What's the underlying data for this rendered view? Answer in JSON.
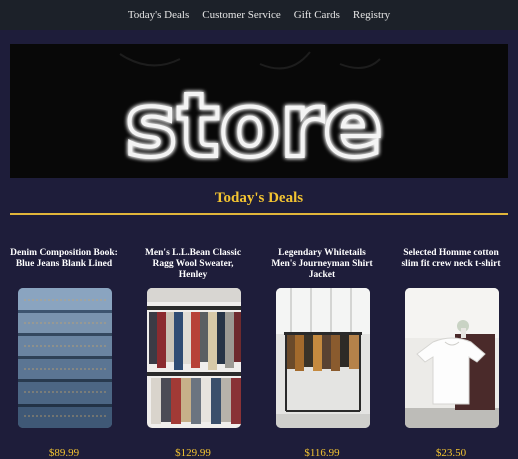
{
  "nav": {
    "links": [
      "Today's Deals",
      "Customer Service",
      "Gift Cards",
      "Registry"
    ]
  },
  "hero": {
    "sign_text": "store"
  },
  "deals": {
    "title": "Today's Deals"
  },
  "products": [
    {
      "name": "Denim Composition Book: Blue Jeans Blank Lined",
      "price": "$89.99",
      "image": "folded-jeans"
    },
    {
      "name": "Men's L.L.Bean Classic Ragg Wool Sweater, Henley",
      "price": "$129.99",
      "image": "clothing-rack"
    },
    {
      "name": "Legendary Whitetails Men's Journeyman Shirt Jacket",
      "price": "$116.99",
      "image": "store-jackets"
    },
    {
      "name": "Selected Homme cotton slim fit crew neck t-shirt",
      "price": "$23.50",
      "image": "white-tshirt"
    }
  ],
  "colors": {
    "background": "#1e1d3a",
    "accent": "#f3c431",
    "nav_bg": "#1c2129"
  }
}
